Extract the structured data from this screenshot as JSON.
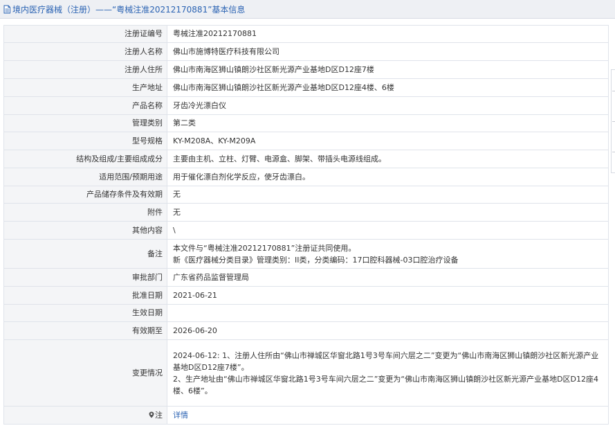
{
  "header": {
    "title": "境内医疗器械（注册）——“粤械注准20212170881”基本信息"
  },
  "rows": [
    {
      "label": "注册证编号",
      "value": "粤械注准20212170881"
    },
    {
      "label": "注册人名称",
      "value": "佛山市施博特医疗科技有限公司"
    },
    {
      "label": "注册人住所",
      "value": "佛山市南海区狮山镇朗沙社区新光源产业基地D区D12座7楼"
    },
    {
      "label": "生产地址",
      "value": "佛山市南海区狮山镇朗沙社区新光源产业基地D区D12座4楼、6楼"
    },
    {
      "label": "产品名称",
      "value": "牙齿冷光漂白仪"
    },
    {
      "label": "管理类别",
      "value": "第二类"
    },
    {
      "label": "型号规格",
      "value": "KY-M208A、KY-M209A"
    },
    {
      "label": "结构及组成/主要组成成分",
      "value": "主要由主机、立柱、灯臂、电源盒、脚架、带插头电源线组成。"
    },
    {
      "label": "适用范围/预期用途",
      "value": "用于催化漂白剂化学反应，使牙齿漂白。"
    },
    {
      "label": "产品储存条件及有效期",
      "value": "无"
    },
    {
      "label": "附件",
      "value": "无"
    },
    {
      "label": "其他内容",
      "value": "\\"
    },
    {
      "label": "备注",
      "lines": [
        "本文件与“粤械注准20212170881”注册证共同使用。",
        "新《医疗器械分类目录》管理类别：II类，分类编码：17口腔科器械-03口腔治疗设备"
      ]
    },
    {
      "label": "审批部门",
      "value": "广东省药品监督管理局"
    },
    {
      "label": "批准日期",
      "value": "2021-06-21"
    },
    {
      "label": "生效日期",
      "value": ""
    },
    {
      "label": "有效期至",
      "value": "2026-06-20"
    },
    {
      "label": "变更情况",
      "lines": [
        "2024-06-12: 1、注册人住所由“佛山市禅城区华窗北路1号3号车间六层之二”变更为“佛山市南海区狮山镇朗沙社区新光源产业基地D区D12座7楼”。",
        "2、生产地址由“佛山市禅城区华窗北路1号3号车间六层之二”变更为“佛山市南海区狮山镇朗沙社区新光源产业基地D区D12座4楼、6楼”。"
      ]
    },
    {
      "label": "注",
      "link": "详情"
    }
  ],
  "colors": {
    "link": "#2b63b3",
    "label_bg": "#f4f5f7",
    "border": "#dfe3ea",
    "header_bg": "#eef0f4"
  },
  "icons": {
    "header": "document-icon",
    "note": "map-pin-icon"
  }
}
